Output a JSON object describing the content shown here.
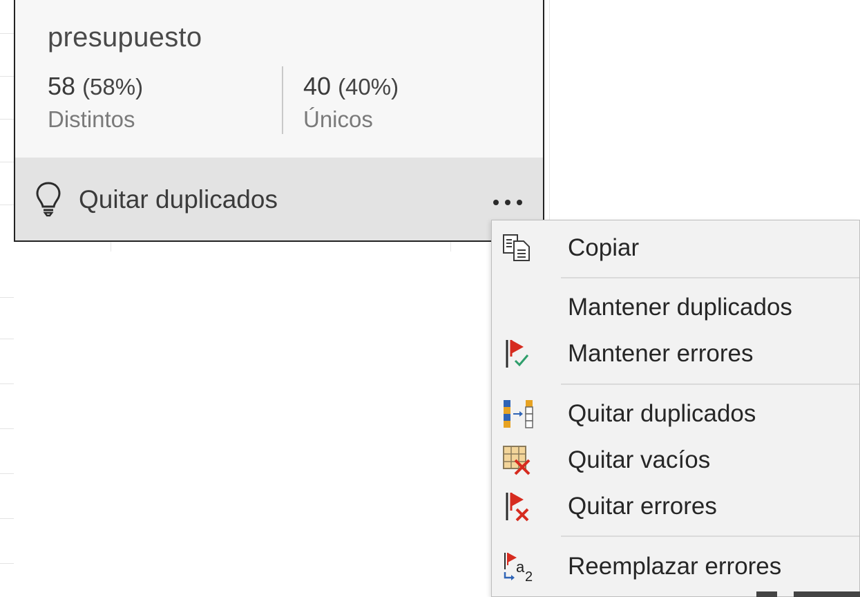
{
  "profile": {
    "column_name": "presupuesto",
    "distinct": {
      "value": "58",
      "percent": "(58%)",
      "label": "Distintos"
    },
    "unique": {
      "value": "40",
      "percent": "(40%)",
      "label": "Únicos"
    },
    "suggestion": {
      "icon": "lightbulb-icon",
      "label": "Quitar duplicados"
    },
    "more_icon": "ellipsis-icon"
  },
  "context_menu": {
    "items": [
      {
        "label": "Copiar",
        "icon": "copy-icon"
      },
      {
        "label": "Mantener duplicados",
        "icon": ""
      },
      {
        "label": "Mantener errores",
        "icon": "keep-errors-icon"
      },
      {
        "label": "Quitar duplicados",
        "icon": "remove-duplicates-icon"
      },
      {
        "label": "Quitar vacíos",
        "icon": "remove-empty-icon"
      },
      {
        "label": "Quitar errores",
        "icon": "remove-errors-icon"
      },
      {
        "label": "Reemplazar errores",
        "icon": "replace-errors-icon"
      }
    ]
  },
  "colors": {
    "flag_red": "#d62b1f",
    "check_green": "#2e9e6b",
    "bar_blue": "#2f64b6",
    "bar_orange": "#e7a323"
  }
}
